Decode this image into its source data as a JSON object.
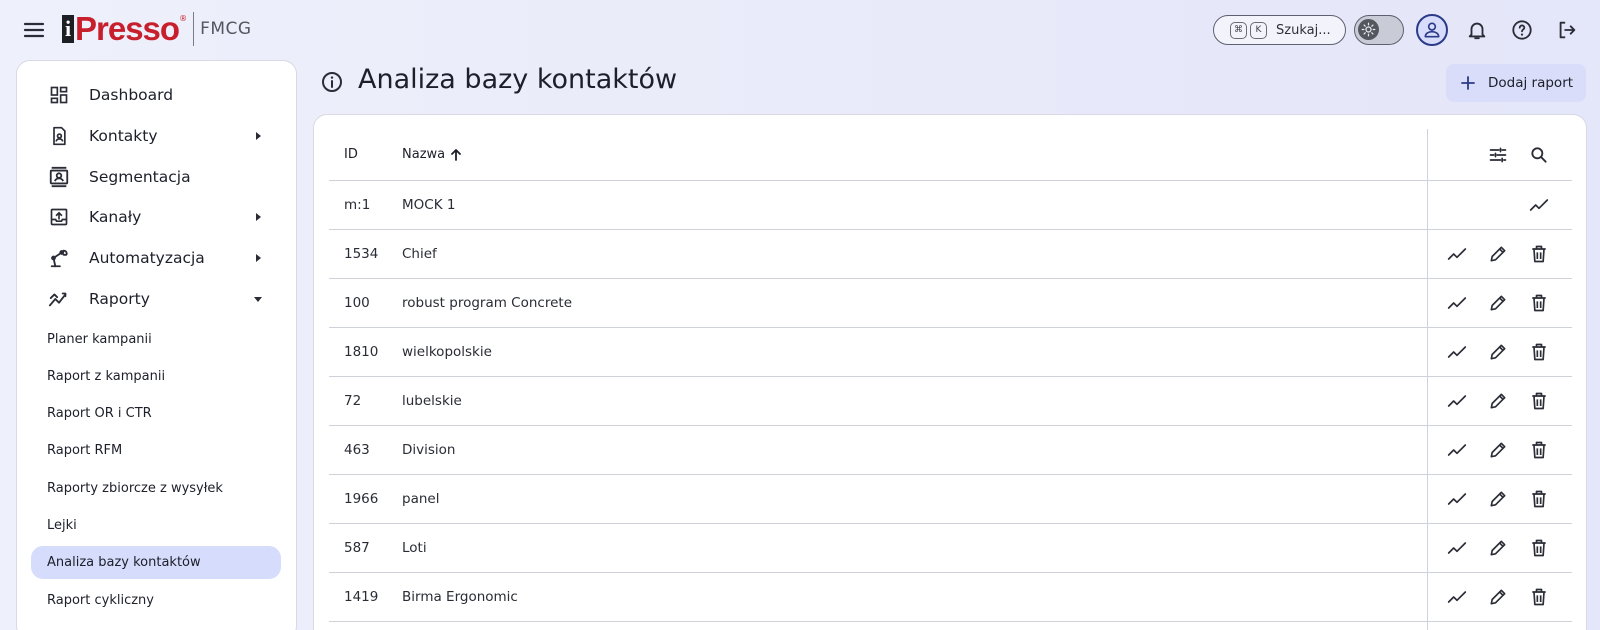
{
  "brand": {
    "logo_text": "Presso",
    "logo_sub": "FMCG"
  },
  "topbar": {
    "search_label": "Szukaj...",
    "kbd_cmd": "⌘",
    "kbd_key": "K"
  },
  "sidebar": {
    "items": [
      {
        "label": "Dashboard",
        "icon": "dashboard-icon",
        "has_caret": false
      },
      {
        "label": "Kontakty",
        "icon": "contacts-icon",
        "has_caret": true,
        "caret": "right"
      },
      {
        "label": "Segmentacja",
        "icon": "segmentation-icon",
        "has_caret": false
      },
      {
        "label": "Kanały",
        "icon": "channels-icon",
        "has_caret": true,
        "caret": "right"
      },
      {
        "label": "Automatyzacja",
        "icon": "automation-icon",
        "has_caret": true,
        "caret": "right"
      },
      {
        "label": "Raporty",
        "icon": "reports-icon",
        "has_caret": true,
        "caret": "down"
      }
    ],
    "sub_items": [
      {
        "label": "Planer kampanii"
      },
      {
        "label": "Raport z kampanii"
      },
      {
        "label": "Raport OR i CTR"
      },
      {
        "label": "Raport RFM"
      },
      {
        "label": "Raporty zbiorcze z wysyłek"
      },
      {
        "label": "Lejki"
      },
      {
        "label": "Analiza bazy kontaktów",
        "active": true
      },
      {
        "label": "Raport cykliczny"
      }
    ]
  },
  "main": {
    "title": "Analiza bazy kontaktów",
    "add_button": "Dodaj raport"
  },
  "table": {
    "columns": {
      "id": "ID",
      "name": "Nazwa"
    },
    "rows": [
      {
        "id": "m:1",
        "name": "MOCK 1",
        "actions": [
          "chart"
        ]
      },
      {
        "id": "1534",
        "name": "Chief",
        "actions": [
          "chart",
          "edit",
          "delete"
        ]
      },
      {
        "id": "100",
        "name": "robust program Concrete",
        "actions": [
          "chart",
          "edit",
          "delete"
        ]
      },
      {
        "id": "1810",
        "name": "wielkopolskie",
        "actions": [
          "chart",
          "edit",
          "delete"
        ]
      },
      {
        "id": "72",
        "name": "lubelskie",
        "actions": [
          "chart",
          "edit",
          "delete"
        ]
      },
      {
        "id": "463",
        "name": "Division",
        "actions": [
          "chart",
          "edit",
          "delete"
        ]
      },
      {
        "id": "1966",
        "name": "panel",
        "actions": [
          "chart",
          "edit",
          "delete"
        ]
      },
      {
        "id": "587",
        "name": "Loti",
        "actions": [
          "chart",
          "edit",
          "delete"
        ]
      },
      {
        "id": "1419",
        "name": "Birma Ergonomic",
        "actions": [
          "chart",
          "edit",
          "delete"
        ]
      }
    ]
  },
  "colors": {
    "brand_red": "#c81f2d",
    "active_bg": "#d6dcfb",
    "accent_blue": "#2a3a88"
  }
}
